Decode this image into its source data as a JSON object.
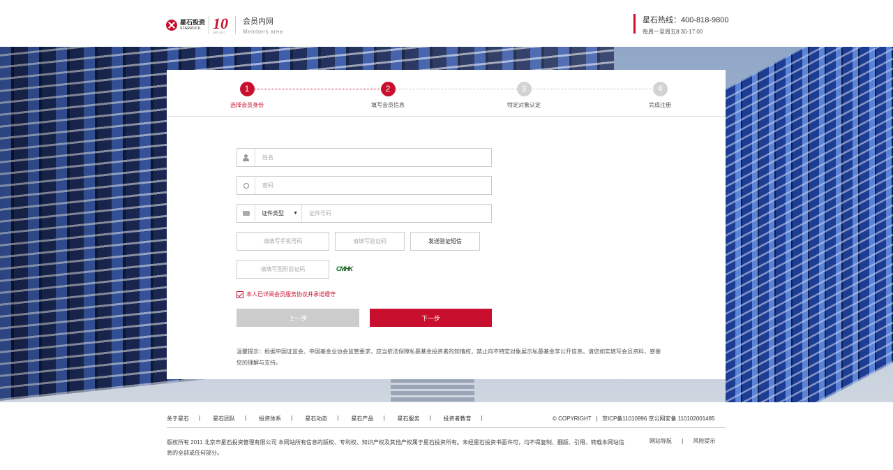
{
  "header": {
    "logo_cn": "星石投资",
    "logo_en": "STARROCK",
    "anniversary": "10",
    "anniversary_years": "2007-2017",
    "area_title": "会员内网",
    "area_subtitle": "Members area",
    "hotline": "星石热线：400-818-9800",
    "hours": "每周一至周五8:30-17:00"
  },
  "steps": [
    {
      "num": "1",
      "label": "选择会员身份",
      "state": "active"
    },
    {
      "num": "2",
      "label": "填写会员信息",
      "state": "done"
    },
    {
      "num": "3",
      "label": "特定对象认定",
      "state": "off"
    },
    {
      "num": "4",
      "label": "完成注册",
      "state": "off"
    }
  ],
  "form": {
    "name_placeholder": "姓名",
    "password_placeholder": "密码",
    "id_type": "证件类型",
    "id_number_placeholder": "证件号码",
    "phone_placeholder": "请填写手机号码",
    "sms_code_placeholder": "请填写验证码",
    "send_sms_button": "发送验证短信",
    "image_code_placeholder": "请填写图形验证码",
    "captcha_text": "CMHK",
    "agree_text": "本人已详阅会员服务协议并承诺遵守",
    "prev_button": "上一步",
    "next_button": "下一步",
    "tip": "温馨提示：根据中国证监会、中国基金业协会监管要求，应当依法保障私募基金投资者的知情权，禁止向不特定对象展示私募基金非公开信息。请您如实填写会员资料，感谢您的理解与支持。"
  },
  "footer": {
    "nav": [
      "关于星石",
      "星石团队",
      "投资体系",
      "星石动态",
      "星石产品",
      "星石服务",
      "投资者教育"
    ],
    "separator": "|",
    "copyright": "© COPYRIGHT",
    "icp": "京ICP备11010996 京公网安备 110102001485",
    "rights": "版权所有 2011 北京市星石投资管理有限公司 本网站所有信息的版权、专利权、知识产权及其他产权属于星石投资所有。未经星石投资书面许可，均不得复制、翻版、引用、转载本网站信息的全部或任何部分。",
    "links": [
      "网站导航",
      "风险提示"
    ]
  },
  "colors": {
    "brand_red": "#c8102e",
    "inactive_gray": "#d3d3d3"
  }
}
